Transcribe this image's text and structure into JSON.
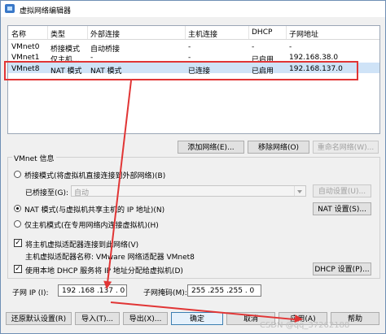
{
  "window": {
    "title": "虚拟网络编辑器"
  },
  "table": {
    "headers": [
      "名称",
      "类型",
      "外部连接",
      "主机连接",
      "DHCP",
      "子网地址"
    ],
    "rows": [
      [
        "VMnet0",
        "桥接模式",
        "自动桥接",
        "-",
        "-",
        "-"
      ],
      [
        "VMnet1",
        "仅主机...",
        "-",
        "-",
        "已启用",
        "192.168.38.0"
      ],
      [
        "VMnet8",
        "NAT 模式",
        "NAT 模式",
        "已连接",
        "已启用",
        "192.168.137.0"
      ]
    ],
    "selected_row": 2
  },
  "network_buttons": {
    "add": "添加网络(E)...",
    "remove": "移除网络(O)",
    "rename": "重命名网络(W)..."
  },
  "vmnet_info": {
    "label": "VMnet 信息",
    "bridged_option": "桥接模式(将虚拟机直接连接到外部网络)(B)",
    "bridged_to_label": "已桥接至(G):",
    "bridged_to_value": "自动",
    "auto_settings_button": "自动设置(U)...",
    "nat_option": "NAT 模式(与虚拟机共享主机的 IP 地址)(N)",
    "nat_settings_button": "NAT 设置(S)...",
    "host_only_option": "仅主机模式(在专用网络内连接虚拟机)(H)",
    "connect_adapter_label": "将主机虚拟适配器连接到此网络(V)",
    "adapter_name_label": "主机虚拟适配器名称: VMware 网络适配器 VMnet8",
    "dhcp_label": "使用本地 DHCP 服务将 IP 地址分配给虚拟机(D)",
    "dhcp_settings_button": "DHCP 设置(P)..."
  },
  "subnet": {
    "ip_label": "子网 IP (I):",
    "ip_value": "192 .168 .137 . 0",
    "mask_label": "子网掩码(M):",
    "mask_value": "255 .255 .255 . 0"
  },
  "footer_buttons": {
    "restore": "还原默认设置(R)",
    "import": "导入(T)...",
    "export": "导出(X)...",
    "ok": "确定",
    "cancel": "取消",
    "apply": "应用(A)",
    "help": "帮助"
  },
  "watermark": "CSDN @qq_37262188",
  "colors": {
    "annotation": "#e13535",
    "selection": "#cfe3f7"
  }
}
